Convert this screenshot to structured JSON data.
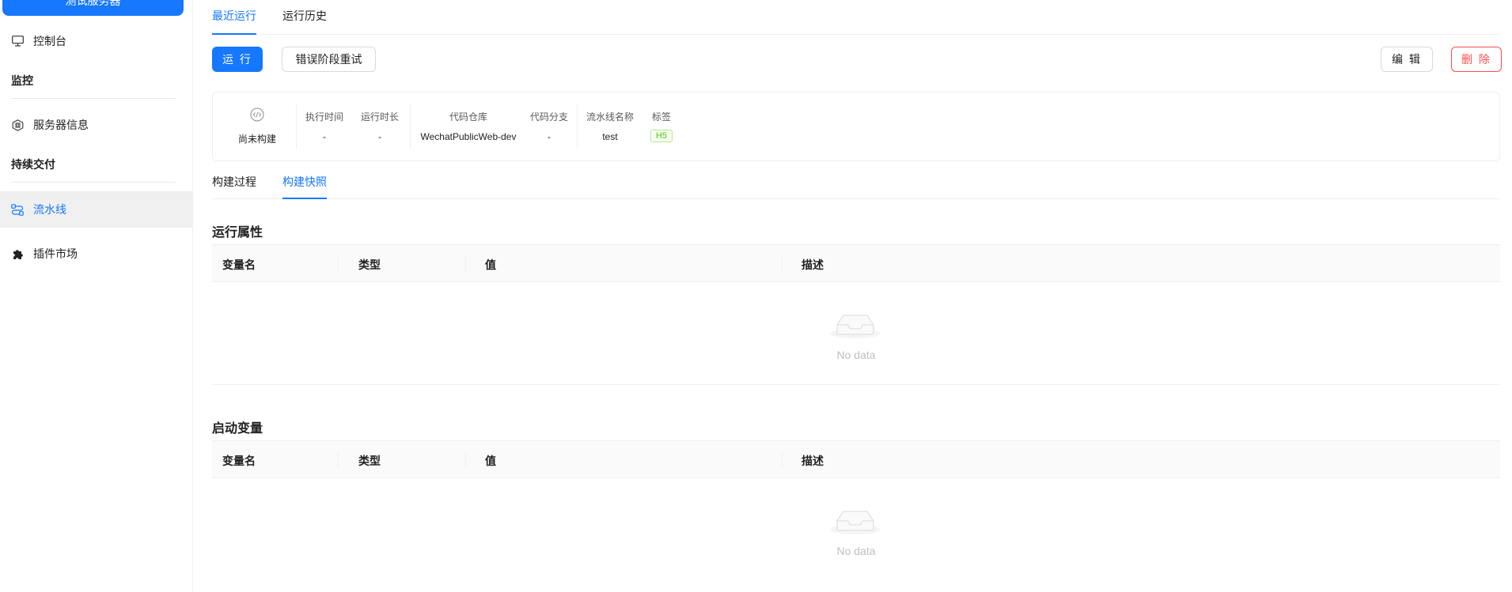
{
  "sidebar": {
    "top_button": "测试服务器",
    "items": [
      {
        "label": "控制台",
        "icon": "monitor-icon"
      },
      {
        "label": "服务器信息",
        "icon": "server-icon"
      },
      {
        "label": "流水线",
        "icon": "pipeline-icon",
        "active": true
      },
      {
        "label": "插件市场",
        "icon": "puzzle-icon"
      }
    ],
    "groups": [
      "监控",
      "持续交付"
    ]
  },
  "tabs": [
    "最近运行",
    "运行历史"
  ],
  "toolbar": {
    "run": "运 行",
    "retry": "错误阶段重试",
    "edit": "编 辑",
    "delete": "删 除"
  },
  "info": {
    "status": "尚未构建",
    "exec_time_label": "执行时间",
    "exec_time": "-",
    "duration_label": "运行时长",
    "duration": "-",
    "repo_label": "代码仓库",
    "repo": "WechatPublicWeb-dev",
    "branch_label": "代码分支",
    "branch": "-",
    "pipeline_label": "流水线名称",
    "pipeline": "test",
    "tag_label": "标签",
    "tag": "H5"
  },
  "subtabs": [
    "构建过程",
    "构建快照"
  ],
  "sections": [
    {
      "title": "运行属性",
      "columns": [
        "变量名",
        "类型",
        "值",
        "描述"
      ],
      "empty": "No data"
    },
    {
      "title": "启动变量",
      "columns": [
        "变量名",
        "类型",
        "值",
        "描述"
      ],
      "empty": "No data"
    }
  ],
  "colors": {
    "primary": "#1677ff",
    "danger": "#ff4d4f",
    "tag_green": "#52c41a"
  }
}
